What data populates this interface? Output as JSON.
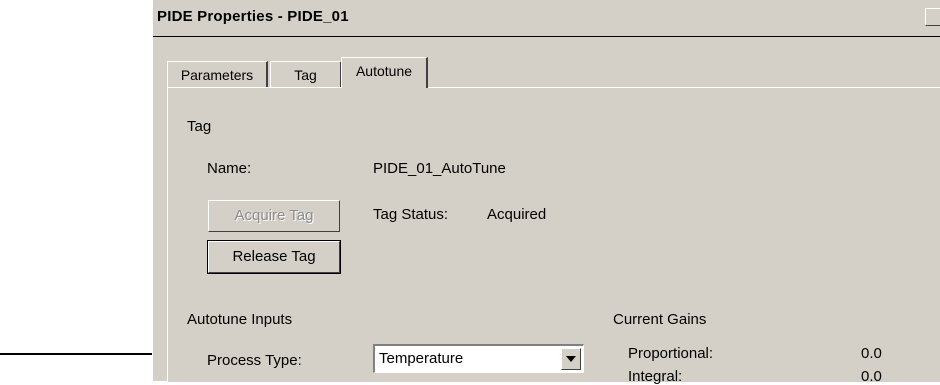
{
  "window": {
    "title": "PIDE Properties - PIDE_01"
  },
  "tabs": [
    {
      "label": "Parameters",
      "active": false
    },
    {
      "label": "Tag",
      "active": false
    },
    {
      "label": "Autotune",
      "active": true
    }
  ],
  "tag_section": {
    "heading": "Tag",
    "name_label": "Name:",
    "name_value": "PIDE_01_AutoTune",
    "acquire_button": "Acquire Tag",
    "release_button": "Release Tag",
    "status_label": "Tag Status:",
    "status_value": "Acquired"
  },
  "autotune_inputs": {
    "heading": "Autotune Inputs",
    "process_type_label": "Process Type:",
    "process_type_value": "Temperature"
  },
  "current_gains": {
    "heading": "Current Gains",
    "rows": [
      {
        "label": "Proportional:",
        "value": "0.0"
      },
      {
        "label": "Integral:",
        "value": "0.0"
      }
    ]
  }
}
